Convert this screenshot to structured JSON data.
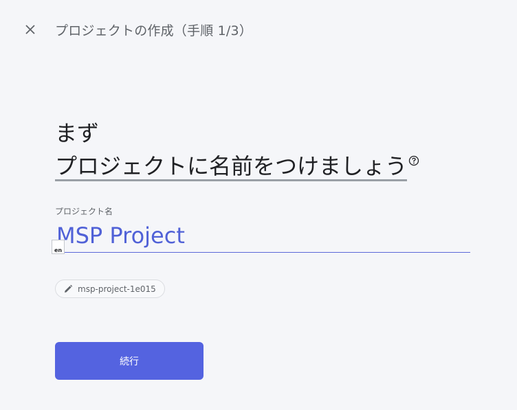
{
  "header": {
    "close_icon": "close-icon",
    "title": "プロジェクトの作成（手順 1/3）"
  },
  "heading": {
    "line1": "まず",
    "line2_underlined": "プロジェクト",
    "line2_rest": "に名前をつけましょう",
    "help_icon": "help-circle-icon"
  },
  "project_name": {
    "label": "プロジェクト名",
    "value": "MSP Project",
    "ime_indicator": "en"
  },
  "project_id_chip": {
    "icon": "pencil-icon",
    "text": "msp-project-1e015"
  },
  "actions": {
    "continue_label": "続行"
  },
  "colors": {
    "accent": "#5463e0",
    "input_text": "#5061d7",
    "background": "#f5f6f9"
  }
}
